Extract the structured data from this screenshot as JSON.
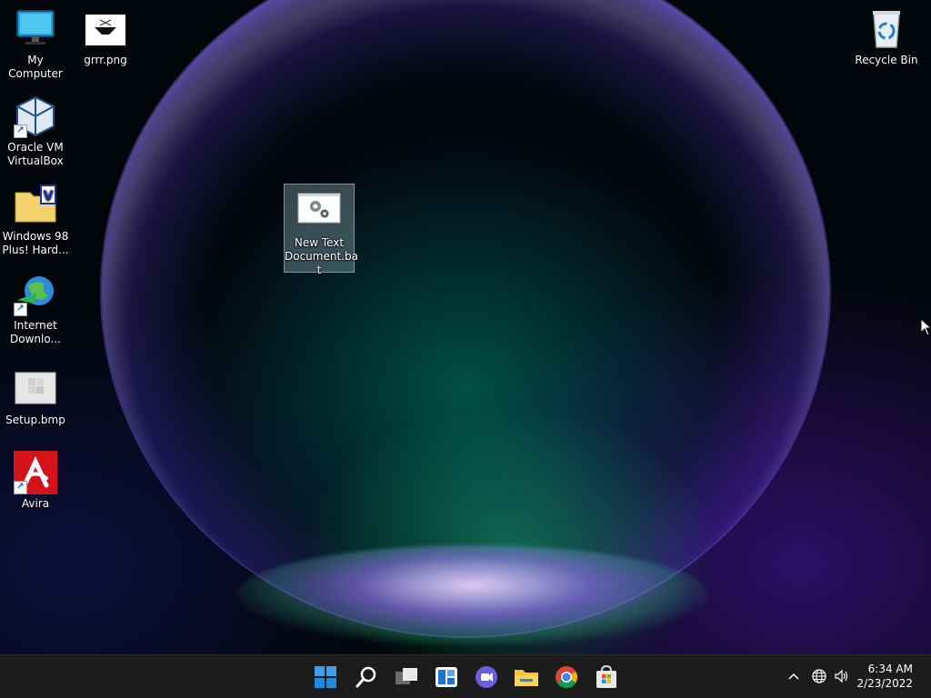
{
  "desktop": {
    "icons": {
      "my_computer": "My Computer",
      "grrr": "grrr.png",
      "recycle_bin": "Recycle Bin",
      "virtualbox": "Oracle VM VirtualBox",
      "win98": "Windows 98 Plus! Hard...",
      "idm": "Internet Downlo...",
      "setup": "Setup.bmp",
      "avira": "Avira",
      "bat_line1": "New Text",
      "bat_line2": "Document.ba",
      "bat_line3": "t"
    }
  },
  "taskbar": {
    "pinned": [
      "start-icon",
      "search-icon",
      "task-view-icon",
      "widgets-icon",
      "teams-chat-icon",
      "file-explorer-icon",
      "chrome-icon",
      "store-icon"
    ],
    "tray": {
      "time": "6:34 AM",
      "date": "2/23/2022"
    }
  },
  "colors": {
    "taskbar_bg": "#1c1c1c",
    "accent": "#0078d4"
  }
}
